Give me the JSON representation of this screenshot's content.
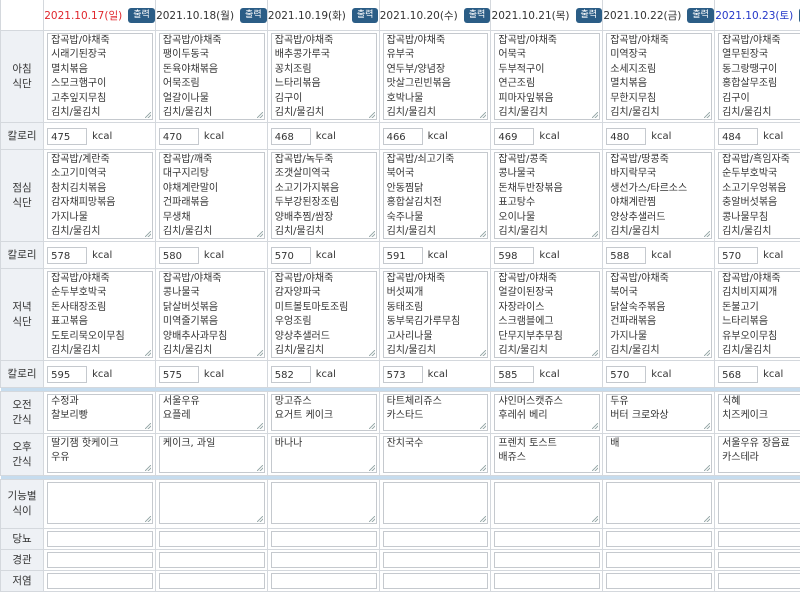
{
  "print_label": "출력",
  "kcal_label": "kcal",
  "days": [
    {
      "date": "2021.10.17(일)",
      "tone": "sun"
    },
    {
      "date": "2021.10.18(월)",
      "tone": ""
    },
    {
      "date": "2021.10.19(화)",
      "tone": ""
    },
    {
      "date": "2021.10.20(수)",
      "tone": ""
    },
    {
      "date": "2021.10.21(목)",
      "tone": ""
    },
    {
      "date": "2021.10.22(금)",
      "tone": ""
    },
    {
      "date": "2021.10.23(토)",
      "tone": "sat"
    }
  ],
  "rows": {
    "breakfast": {
      "label": [
        "아침",
        "식단"
      ],
      "menus": [
        [
          "잡곡밥/야채죽",
          "시래기된장국",
          "멸치볶음",
          "스모크햄구이",
          "고추잎지무침",
          "김치/물김치"
        ],
        [
          "잡곡밥/야채죽",
          "팽이두동국",
          "돈육야채볶음",
          "어묵조림",
          "얼갈이나물",
          "김치/물김치"
        ],
        [
          "잡곡밥/야채죽",
          "배추콩가루국",
          "꽁치조림",
          "느타리볶음",
          "김구이",
          "김치/물김치"
        ],
        [
          "잡곡밥/야채죽",
          "유부국",
          "연두부/양념장",
          "맛살그린빈볶음",
          "호박나물",
          "김치/물김치"
        ],
        [
          "잡곡밥/야채죽",
          "어묵국",
          "두부적구이",
          "연근조림",
          "피마자잎볶음",
          "김치/물김치"
        ],
        [
          "잡곡밥/야채죽",
          "미역장국",
          "소세지조림",
          "멸치볶음",
          "무한지무침",
          "김치/물김치"
        ],
        [
          "잡곡밥/야채죽",
          "열무된장국",
          "동그랑땡구이",
          "홍합살무조림",
          "김구이",
          "김치/물김치"
        ]
      ],
      "kcal": [
        "475",
        "470",
        "468",
        "466",
        "469",
        "480",
        "484"
      ]
    },
    "lunch": {
      "label": [
        "점심",
        "식단"
      ],
      "menus": [
        [
          "잡곡밥/계란죽",
          "소고기미역국",
          "참치김치볶음",
          "감자채피망볶음",
          "가지나물",
          "김치/물김치"
        ],
        [
          "잡곡밥/깨죽",
          "대구지리탕",
          "야채계란말이",
          "건파래볶음",
          "무생채",
          "김치/물김치"
        ],
        [
          "잡곡밥/녹두죽",
          "조갯살미역국",
          "소고기가지볶음",
          "두부강된장조림",
          "양배추찜/쌈장",
          "김치/물김치"
        ],
        [
          "잡곡밥/쇠고기죽",
          "북어국",
          "안동찜닭",
          "홍합살김치전",
          "숙주나물",
          "김치/물김치"
        ],
        [
          "잡곡밥/콩죽",
          "콩나물국",
          "돈채두반장볶음",
          "표고탕수",
          "오이나물",
          "김치/물김치"
        ],
        [
          "잡곡밥/땅콩죽",
          "바지락무국",
          "생선가스/타르소스",
          "야채계란찜",
          "양상추샐러드",
          "김치/물김치"
        ],
        [
          "잡곡밥/흑임자죽",
          "순두부호박국",
          "소고기우엉볶음",
          "충알버섯볶음",
          "콩나물무침",
          "김치/물김치"
        ]
      ],
      "kcal": [
        "578",
        "580",
        "570",
        "591",
        "598",
        "588",
        "570"
      ]
    },
    "dinner": {
      "label": [
        "저녁",
        "식단"
      ],
      "menus": [
        [
          "잡곡밥/야채죽",
          "순두부호박국",
          "돈사태장조림",
          "표고볶음",
          "도토리묵오이무침",
          "김치/물김치"
        ],
        [
          "잡곡밥/야채죽",
          "콩나물국",
          "닭살버섯볶음",
          "미역줄기볶음",
          "양배추사과무침",
          "김치/물김치"
        ],
        [
          "잡곡밥/야채죽",
          "감자양파국",
          "미트볼토마토조림",
          "우엉조림",
          "양상추샐러드",
          "김치/물김치"
        ],
        [
          "잡곡밥/야채죽",
          "버섯찌개",
          "동태조림",
          "동부묵김가루무침",
          "고사리나물",
          "김치/물김치"
        ],
        [
          "잡곡밥/야채죽",
          "얼갈이된장국",
          "자장라이스",
          "스크램블에그",
          "단무지부추무침",
          "김치/물김치"
        ],
        [
          "잡곡밥/야채죽",
          "북어국",
          "닭살숙주볶음",
          "건파래볶음",
          "가지나물",
          "김치/물김치"
        ],
        [
          "잡곡밥/야채죽",
          "김치비지찌개",
          "돈불고기",
          "느타리볶음",
          "유부오이무침",
          "김치/물김치"
        ]
      ],
      "kcal": [
        "595",
        "575",
        "582",
        "573",
        "585",
        "570",
        "568"
      ]
    },
    "am_snack": {
      "label": [
        "오전",
        "간식"
      ],
      "items": [
        [
          "수정과",
          "찰보리빵"
        ],
        [
          "서울우유",
          "요플레"
        ],
        [
          "망고쥬스",
          "요거트 케이크"
        ],
        [
          "타트체리쥬스",
          "카스타드"
        ],
        [
          "샤인머스캣쥬스",
          "후레쉬 베리"
        ],
        [
          "두유",
          "버터 크로와상"
        ],
        [
          "식혜",
          "치즈케이크"
        ]
      ]
    },
    "pm_snack": {
      "label": [
        "오후",
        "간식"
      ],
      "items": [
        [
          "딸기잼 핫케이크",
          "우유"
        ],
        [
          "케이크, 과일"
        ],
        [
          "바나나"
        ],
        [
          "잔치국수"
        ],
        [
          "프렌치 토스트",
          "배쥬스"
        ],
        [
          "배"
        ],
        [
          "서울우유 장음료",
          "카스테라"
        ]
      ]
    },
    "functional": {
      "label": [
        "기능별",
        "식이"
      ]
    },
    "diabetes": {
      "label": [
        "당뇨"
      ]
    },
    "tube": {
      "label": [
        "경관"
      ]
    },
    "low_salt": {
      "label": [
        "저염"
      ]
    }
  }
}
